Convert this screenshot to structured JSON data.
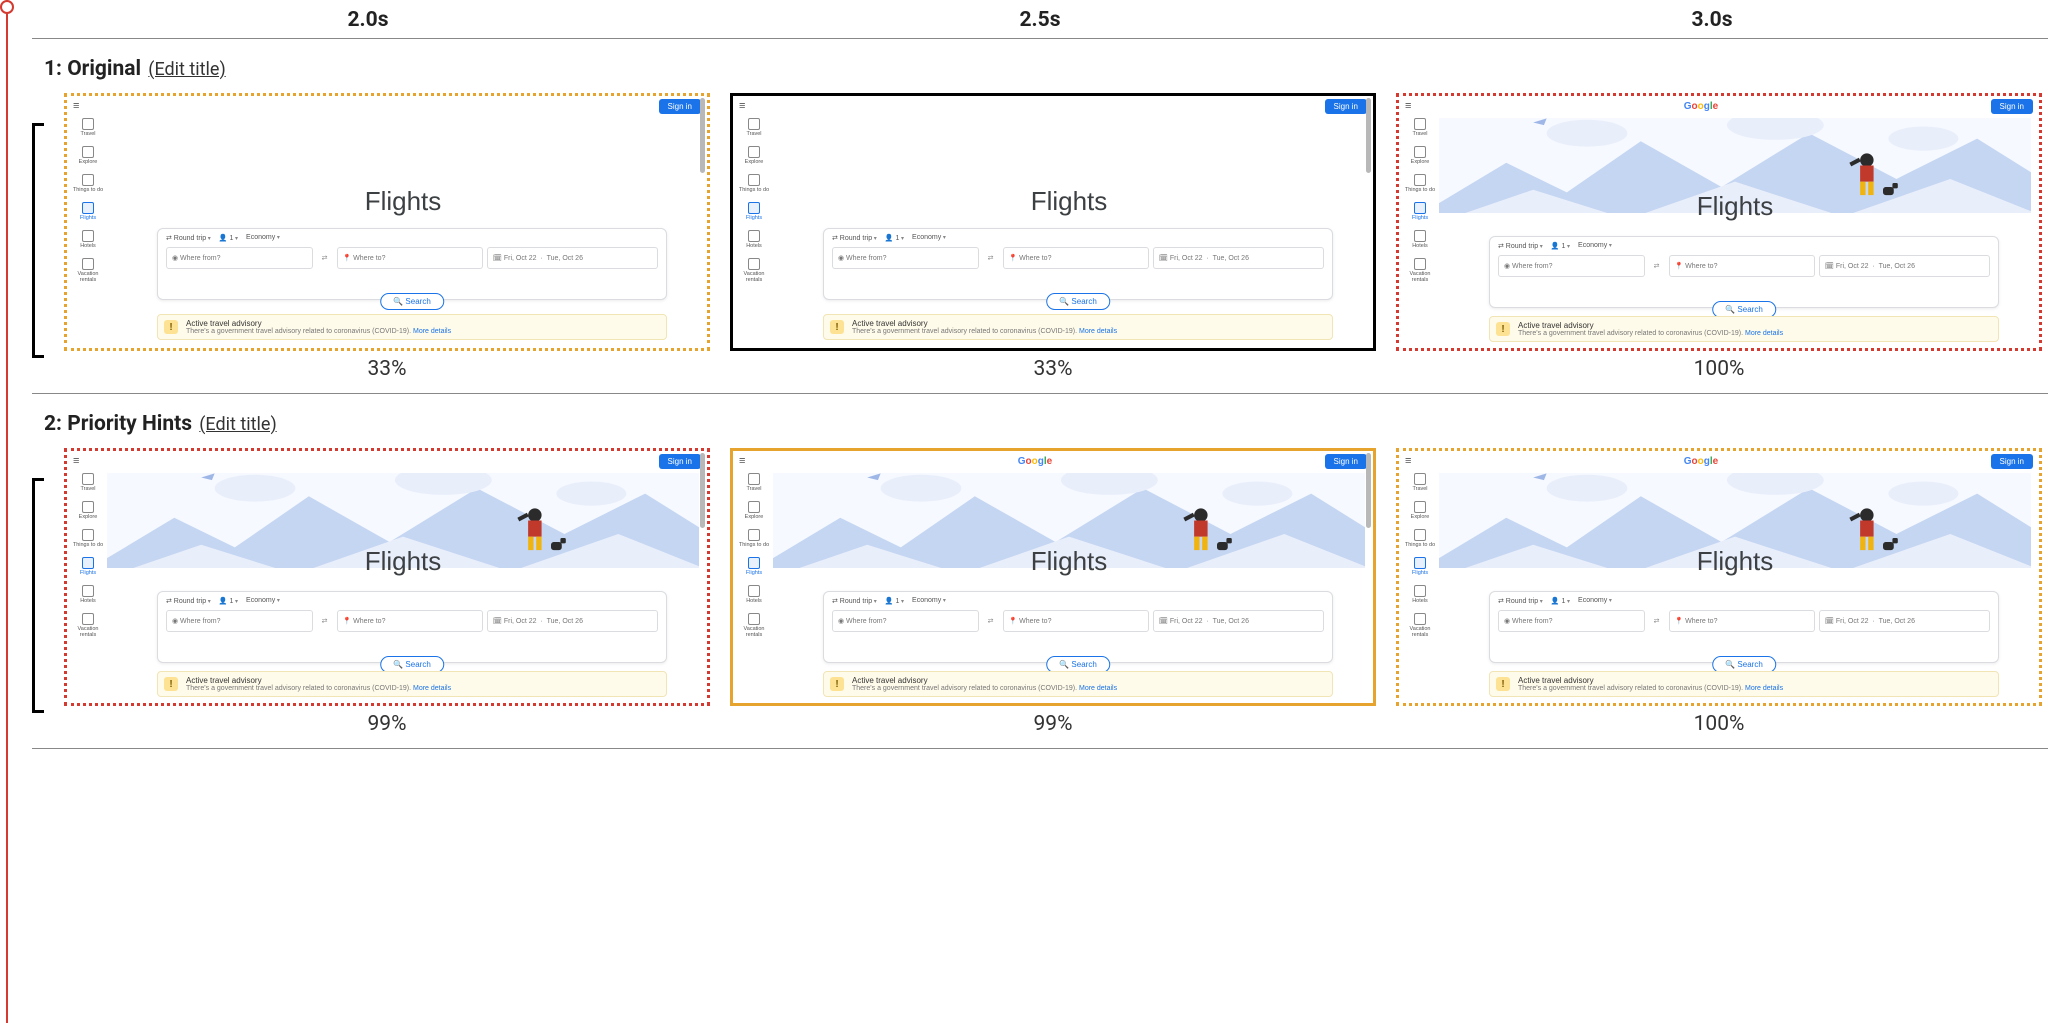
{
  "timeHeaders": [
    "2.0s",
    "2.5s",
    "3.0s"
  ],
  "sections": [
    {
      "index": "1",
      "name": "Original",
      "editLabel": "(Edit title)",
      "frames": [
        {
          "border": "b-dotted-orange",
          "percent": "33%",
          "hero": false,
          "logo": false,
          "scrollbar": true
        },
        {
          "border": "b-solid-black",
          "percent": "33%",
          "hero": false,
          "logo": false,
          "scrollbar": true
        },
        {
          "border": "b-dotted-red",
          "percent": "100%",
          "hero": true,
          "logo": true,
          "scrollbar": false
        }
      ]
    },
    {
      "index": "2",
      "name": "Priority Hints",
      "editLabel": "(Edit title)",
      "frames": [
        {
          "border": "b-dotted-red",
          "percent": "99%",
          "hero": true,
          "logo": false,
          "scrollbar": true
        },
        {
          "border": "b-solid-orange",
          "percent": "99%",
          "hero": true,
          "logo": true,
          "scrollbar": true
        },
        {
          "border": "b-dotted-orange",
          "percent": "100%",
          "hero": true,
          "logo": true,
          "scrollbar": false
        }
      ]
    }
  ],
  "thumb": {
    "signin": "Sign in",
    "title": "Flights",
    "sidebar": [
      "Travel",
      "Explore",
      "Things to do",
      "Flights",
      "Hotels",
      "Vacation rentals"
    ],
    "sidebarActiveIndex": 3,
    "chips": {
      "trip": "Round trip",
      "pax": "1",
      "cabin": "Economy"
    },
    "fields": {
      "from": "Where from?",
      "to": "Where to?",
      "dep": "Fri, Oct 22",
      "ret": "Tue, Oct 26"
    },
    "search": "Search",
    "advisory": {
      "title": "Active travel advisory",
      "body": "There's a government travel advisory related to coronavirus (COVID-19).",
      "link": "More details"
    }
  }
}
